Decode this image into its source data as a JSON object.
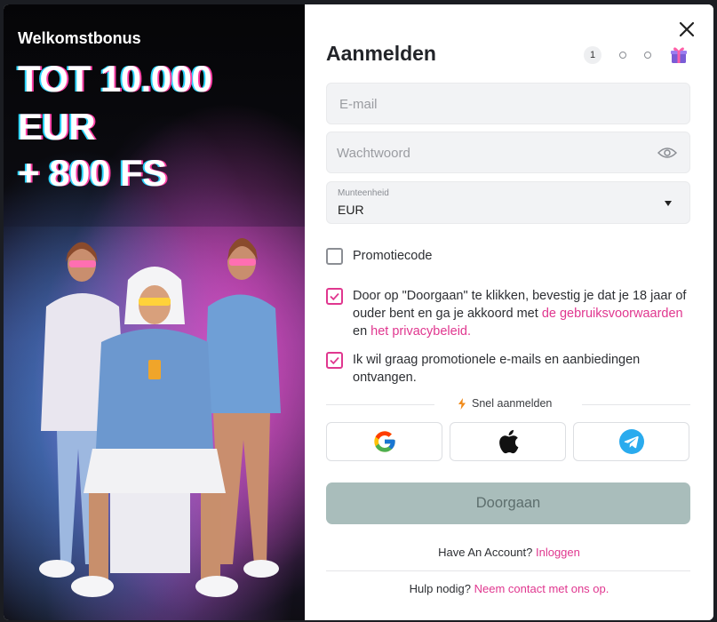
{
  "promo": {
    "subtitle": "Welkomstbonus",
    "line1": "TOT 10.000",
    "line2": "EUR",
    "line3": "+ 800 FS"
  },
  "form": {
    "title": "Aanmelden",
    "step_current": "1",
    "email_placeholder": "E-mail",
    "password_placeholder": "Wachtwoord",
    "currency_label": "Munteenheid",
    "currency_value": "EUR",
    "promo_code_label": "Promotiecode",
    "promo_code_checked": false,
    "terms_text_1": "Door op \"Doorgaan\" te klikken, bevestig je dat je 18 jaar of ouder bent en ga je akkoord met ",
    "terms_link": "de gebruiksvoorwaarden",
    "terms_and": " en ",
    "privacy_link": "het privacybeleid.",
    "terms_checked": true,
    "marketing_text": "Ik wil graag promotionele e-mails en aanbiedingen ontvangen.",
    "marketing_checked": true,
    "quick_signup": "Snel aanmelden",
    "social": [
      "google-icon",
      "apple-icon",
      "telegram-icon"
    ],
    "submit_label": "Doorgaan",
    "account_text": "Have An Account? ",
    "login_link": "Inloggen",
    "help_text": "Hulp nodig? ",
    "contact_link": "Neem contact met ons op."
  },
  "colors": {
    "accent": "#e0378f",
    "submit_disabled": "#a9bdbb",
    "field_bg": "#f2f3f5"
  }
}
